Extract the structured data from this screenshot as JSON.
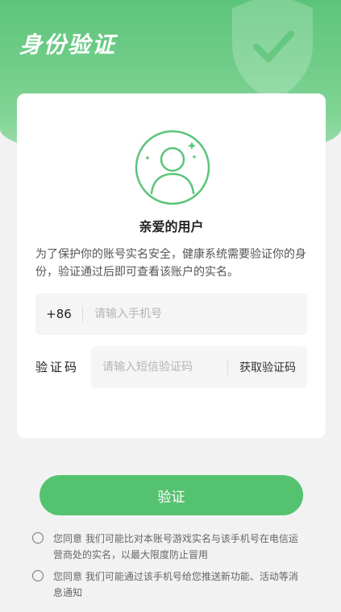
{
  "header": {
    "title": "身份验证"
  },
  "card": {
    "greeting": "亲爱的用户",
    "description": "为了保护你的账号实名安全，健康系统需要验证你的身份，验证通过后即可查看该账户的实名。",
    "phone": {
      "country_code": "+86",
      "placeholder": "请输入手机号"
    },
    "code": {
      "label": "验证码",
      "placeholder": "请输入短信验证码",
      "get_code_label": "获取验证码"
    }
  },
  "actions": {
    "verify_label": "验证"
  },
  "agreements": [
    {
      "text": "您同意 我们可能比对本账号游戏实名与该手机号在电信运营商处的实名，以最大限度防止冒用"
    },
    {
      "text": "您同意 我们可能通过该手机号给您推送新功能、活动等消息通知"
    }
  ],
  "colors": {
    "accent": "#55c26f",
    "header": "#5cc47a"
  }
}
